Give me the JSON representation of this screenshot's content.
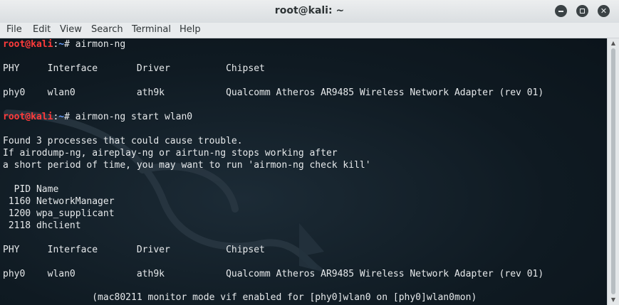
{
  "window": {
    "title": "root@kali: ~"
  },
  "menu": [
    "File",
    "Edit",
    "View",
    "Search",
    "Terminal",
    "Help"
  ],
  "prompt": {
    "user": "root@kali",
    "sep": ":",
    "path": "~",
    "symbol": "# "
  },
  "terminal": {
    "cmd1": "airmon-ng",
    "table_header": "PHY     Interface       Driver          Chipset",
    "row": "phy0    wlan0           ath9k           Qualcomm Atheros AR9485 Wireless Network Adapter (rev 01)",
    "cmd2": "airmon-ng start wlan0",
    "warn1": "Found 3 processes that could cause trouble.",
    "warn2": "If airodump-ng, aireplay-ng or airtun-ng stops working after",
    "warn3": "a short period of time, you may want to run 'airmon-ng check kill'",
    "pid_header": "  PID Name",
    "pid1": " 1160 NetworkManager",
    "pid2": " 1200 wpa_supplicant",
    "pid3": " 2118 dhclient",
    "table_header2": "PHY     Interface       Driver          Chipset",
    "row2": "phy0    wlan0           ath9k           Qualcomm Atheros AR9485 Wireless Network Adapter (rev 01)",
    "monitor": "                (mac80211 monitor mode vif enabled for [phy0]wlan0 on [phy0]wlan0mon)"
  },
  "colors": {
    "prompt_user": "#ff3b3b",
    "prompt_path": "#6aa0ff",
    "terminal_bg": "#0f1b24"
  }
}
